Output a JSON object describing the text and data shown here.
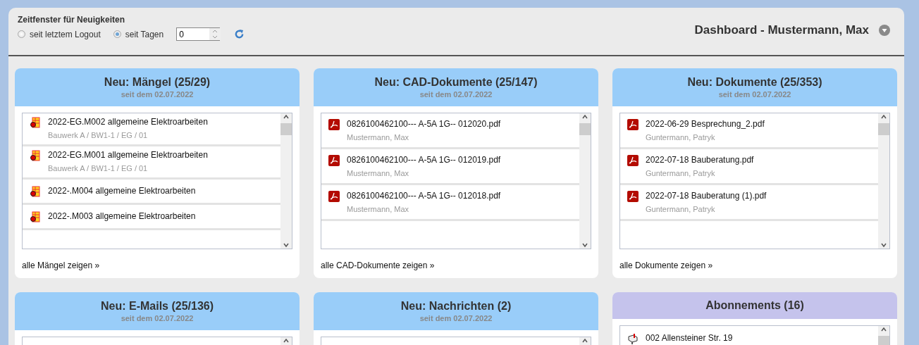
{
  "filter": {
    "title": "Zeitfenster für Neuigkeiten",
    "options": [
      {
        "label": "seit letztem Logout",
        "selected": false
      },
      {
        "label": "seit Tagen",
        "selected": true
      }
    ],
    "days": "0"
  },
  "header": {
    "title": "Dashboard - Mustermann, Max"
  },
  "widgets": [
    {
      "kind": "news",
      "title": "Neu: Mängel (25/29)",
      "subtitle": "seit dem 02.07.2022",
      "items": [
        {
          "kind": "defect",
          "title": "2022-EG.M002 allgemeine Elektroarbeiten",
          "detail": "Bauwerk A / BW1-1 / EG / 01"
        },
        {
          "kind": "defect",
          "title": "2022-EG.M001 allgemeine Elektroarbeiten",
          "detail": "Bauwerk A / BW1-1 / EG / 01"
        },
        {
          "kind": "defect",
          "title": "2022-.M004 allgemeine Elektroarbeiten"
        },
        {
          "kind": "defect",
          "title": "2022-.M003 allgemeine Elektroarbeiten"
        }
      ],
      "link": "alle Mängel zeigen »"
    },
    {
      "kind": "news",
      "title": "Neu: CAD-Dokumente (25/147)",
      "subtitle": "seit dem 02.07.2022",
      "items": [
        {
          "kind": "pdf",
          "title": "0826100462100--- A-5A 1G-- 012020.pdf",
          "detail": "Mustermann, Max"
        },
        {
          "kind": "pdf",
          "title": "0826100462100--- A-5A 1G-- 012019.pdf",
          "detail": "Mustermann, Max"
        },
        {
          "kind": "pdf",
          "title": "0826100462100--- A-5A 1G-- 012018.pdf",
          "detail": "Mustermann, Max"
        }
      ],
      "link": "alle CAD-Dokumente zeigen »"
    },
    {
      "kind": "news",
      "title": "Neu: Dokumente (25/353)",
      "subtitle": "seit dem 02.07.2022",
      "items": [
        {
          "kind": "pdf",
          "title": "2022-06-29 Besprechung_2.pdf",
          "detail": "Guntermann, Patryk"
        },
        {
          "kind": "pdf",
          "title": "2022-07-18 Bauberatung.pdf",
          "detail": "Guntermann, Patryk"
        },
        {
          "kind": "pdf",
          "title": "2022-07-18 Bauberatung (1).pdf",
          "detail": "Guntermann, Patryk"
        }
      ],
      "link": "alle Dokumente zeigen »"
    },
    {
      "kind": "news",
      "title": "Neu: E-Mails (25/136)",
      "subtitle": "seit dem 02.07.2022"
    },
    {
      "kind": "news",
      "title": "Neu: Nachrichten (2)",
      "subtitle": "seit dem 02.07.2022"
    },
    {
      "kind": "subscription",
      "title": "Abonnements (16)",
      "items": [
        {
          "kind": "mailbox",
          "title": "002 Allensteiner Str. 19"
        }
      ]
    }
  ]
}
